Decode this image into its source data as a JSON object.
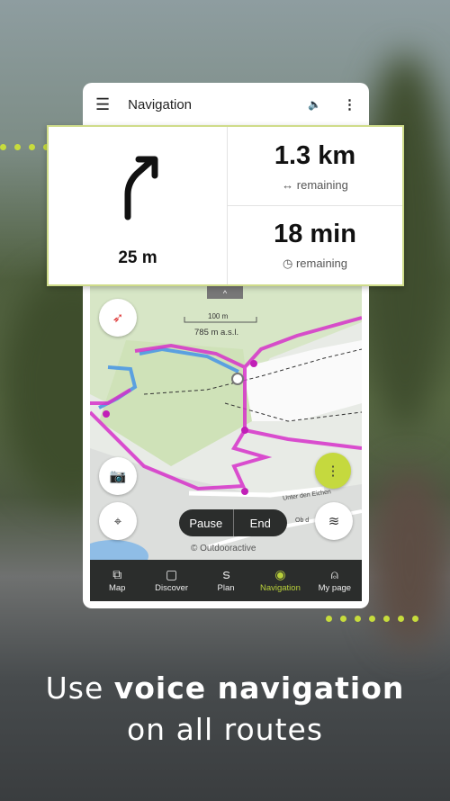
{
  "app": {
    "title": "Navigation",
    "menu_icon": "hamburger-icon",
    "sound_icon": "speaker-icon",
    "more_icon": "more-vert-icon"
  },
  "instruction": {
    "icon": "turn-slight-right-arrow-icon",
    "distance": "25 m"
  },
  "stats": [
    {
      "value": "1.3 km",
      "icon": "left-right-arrow-icon",
      "label": "remaining"
    },
    {
      "value": "18 min",
      "icon": "clock-icon",
      "label": "remaining"
    }
  ],
  "map": {
    "scale": "100 m",
    "altitude": "785 m a.s.l.",
    "attribution": "© Outdooractive",
    "street1": "Unter den Eichen",
    "street2": "Ob d",
    "pause": "Pause",
    "end": "End",
    "route_color": "#d631c9",
    "track_color": "#5aa0e0"
  },
  "nav": [
    {
      "label": "Map",
      "icon": "map-search-icon"
    },
    {
      "label": "Discover",
      "icon": "discover-icon"
    },
    {
      "label": "Plan",
      "icon": "plan-route-icon"
    },
    {
      "label": "Navigation",
      "icon": "navigation-icon",
      "active": true
    },
    {
      "label": "My page",
      "icon": "person-icon"
    }
  ],
  "caption": {
    "pre": "Use ",
    "bold": "voice navigation",
    "line2": "on all routes"
  },
  "colors": {
    "accent": "#b8cf3a",
    "navbar": "#2b2d2c"
  }
}
